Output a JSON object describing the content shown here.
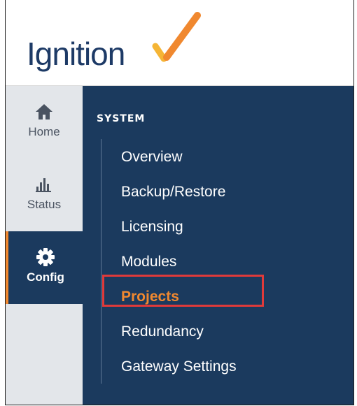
{
  "brand": {
    "logo_text": "Ignition",
    "accent_color": "#f0882f",
    "logo_text_color": "#1d3a66"
  },
  "sidebar": {
    "items": [
      {
        "label": "Home",
        "icon": "home-icon"
      },
      {
        "label": "Status",
        "icon": "bar-chart-icon"
      },
      {
        "label": "Config",
        "icon": "gear-icon",
        "active": true
      }
    ],
    "active_bg": "#1b3a5e",
    "bg": "#e3e6ea"
  },
  "main": {
    "section_title": "SYSTEM",
    "menu": [
      {
        "label": "Overview"
      },
      {
        "label": "Backup/Restore"
      },
      {
        "label": "Licensing"
      },
      {
        "label": "Modules"
      },
      {
        "label": "Projects",
        "selected": true
      },
      {
        "label": "Redundancy"
      },
      {
        "label": "Gateway Settings"
      }
    ],
    "bg": "#1b3a5e",
    "highlight_color": "#e03a3a"
  }
}
